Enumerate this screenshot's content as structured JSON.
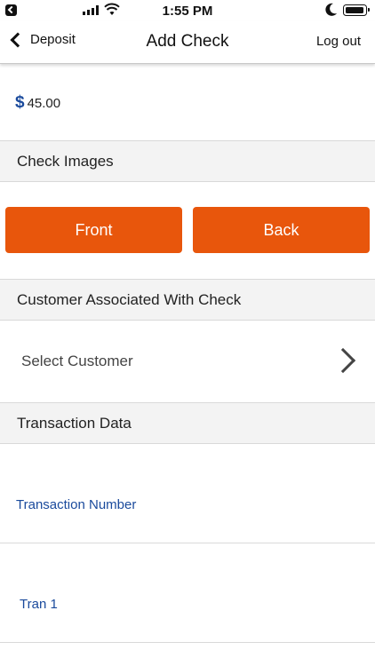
{
  "status_bar": {
    "time": "1:55 PM",
    "icons": [
      "back-to-app-icon",
      "signal-icon",
      "wifi-icon",
      "moon-icon",
      "battery-icon"
    ]
  },
  "nav": {
    "back_label": "Deposit",
    "title": "Add Check",
    "logout_label": "Log out"
  },
  "amount": {
    "currency_symbol": "$",
    "value": "45.00"
  },
  "sections": {
    "check_images": "Check Images",
    "customer": "Customer Associated With Check",
    "transaction": "Transaction Data"
  },
  "buttons": {
    "front": "Front",
    "back": "Back"
  },
  "customer": {
    "select_label": "Select Customer"
  },
  "transaction": {
    "field_label": "Transaction Number",
    "field_value": "Tran 1"
  },
  "colors": {
    "accent_orange": "#e8560c",
    "link_blue": "#1a4a9c",
    "section_bg": "#f3f3f3"
  }
}
